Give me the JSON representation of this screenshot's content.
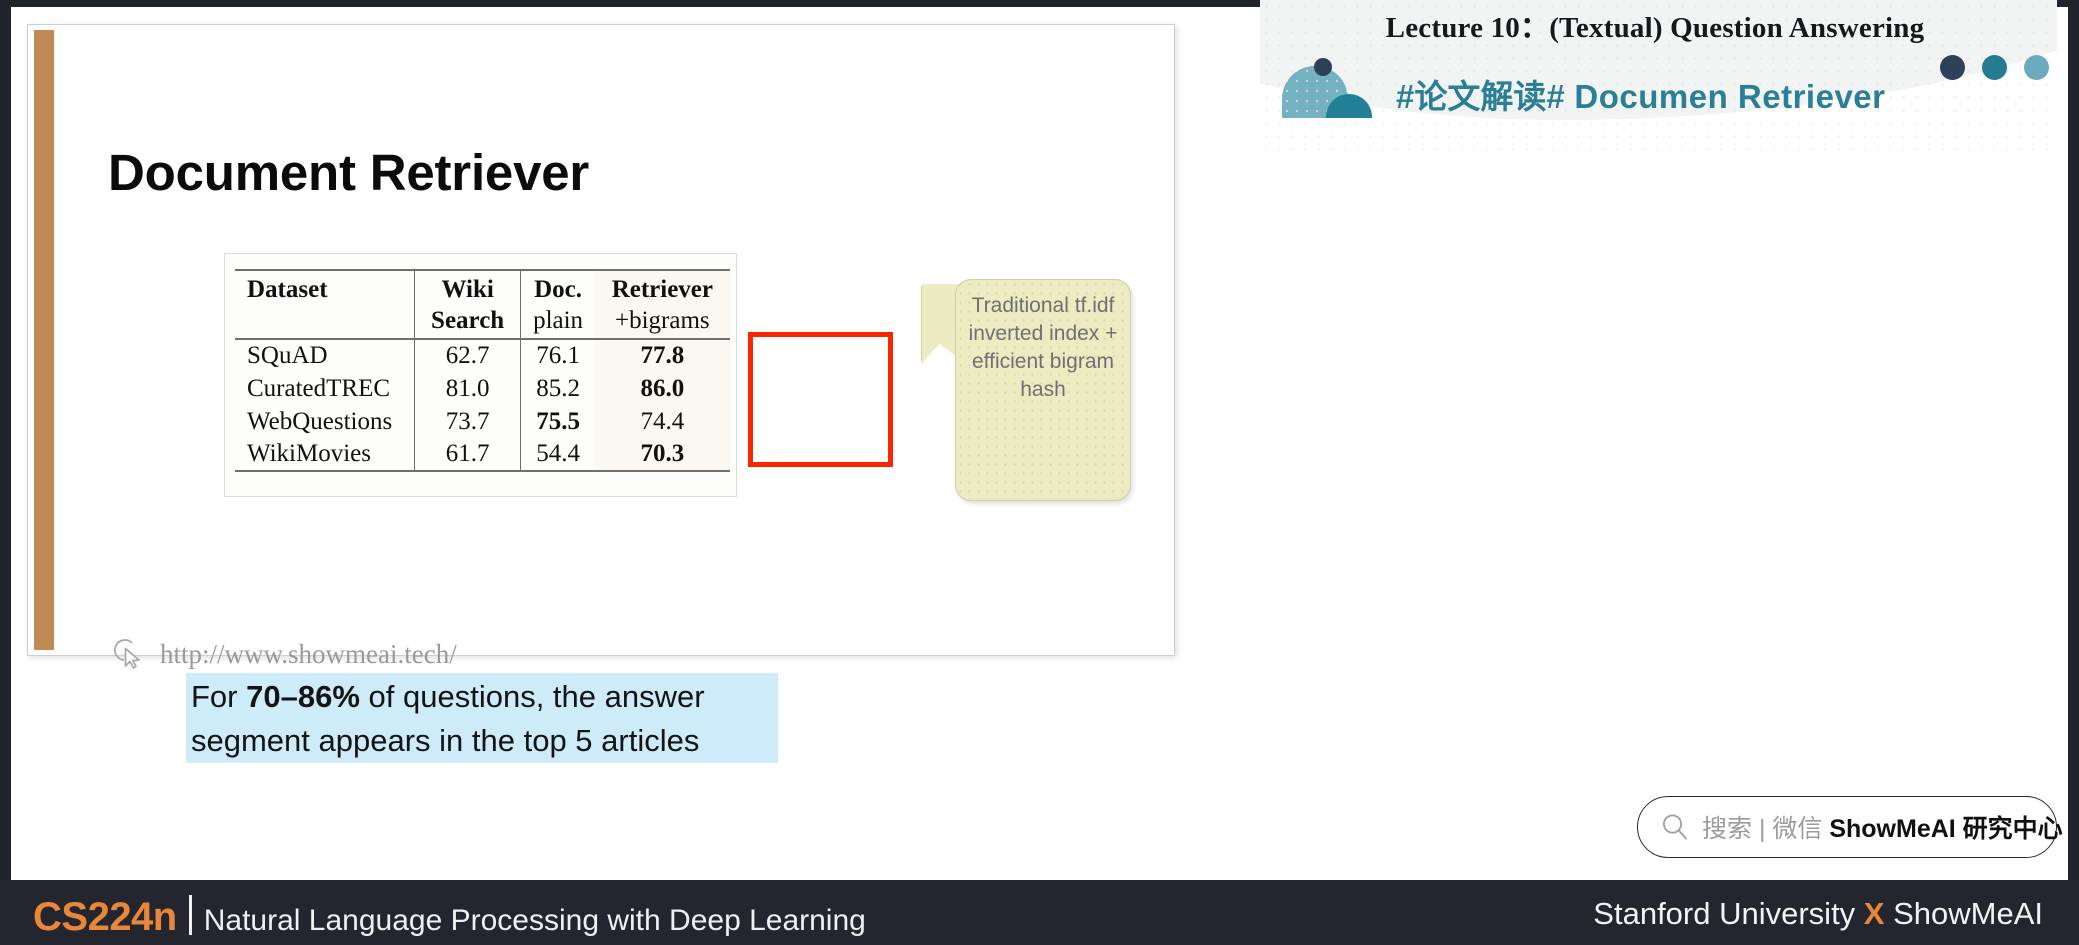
{
  "header": {
    "lecture_title": "Lecture 10：(Textual) Question Answering",
    "logo_text_cn": "#论文解读#",
    "logo_text_en": "Documen Retriever",
    "dot_colors": [
      "#2d4159",
      "#247b92",
      "#6babbd"
    ],
    "accent_teal": "#2a7f96"
  },
  "slide": {
    "title": "Document Retriever",
    "accent_bar_color": "#c08a56",
    "url": "http://www.showmeai.tech/",
    "callout": "Traditional tf.idf inverted index + efficient bigram hash",
    "highlight": {
      "line1_pre": "For ",
      "line1_bold": "70–86%",
      "line1_post": " of questions, the answer",
      "line2": "segment appears in the top 5 articles",
      "bg_color": "#cdebf8"
    },
    "red_box_color": "#fa2600"
  },
  "table": {
    "headers_row1": [
      "Dataset",
      "Wiki",
      "Doc.",
      "Retriever"
    ],
    "headers_row2": [
      "",
      "Search",
      "plain",
      "+bigrams"
    ],
    "rows": [
      {
        "dataset": "SQuAD",
        "wiki_search": "62.7",
        "doc_plain": "76.1",
        "doc_bigrams": "77.8"
      },
      {
        "dataset": "CuratedTREC",
        "wiki_search": "81.0",
        "doc_plain": "85.2",
        "doc_bigrams": "86.0"
      },
      {
        "dataset": "WebQuestions",
        "wiki_search": "73.7",
        "doc_plain": "75.5",
        "doc_bigrams": "74.4"
      },
      {
        "dataset": "WikiMovies",
        "wiki_search": "61.7",
        "doc_plain": "54.4",
        "doc_bigrams": "70.3"
      }
    ]
  },
  "search": {
    "placeholder_grey": "搜索 | 微信 ",
    "brand": "ShowMeAI 研究中心"
  },
  "footer": {
    "course_code": "CS224n",
    "course_name": "Natural Language Processing with Deep Learning",
    "right_pre": "Stanford University ",
    "right_x": "X",
    "right_post": " ShowMeAI",
    "accent_color": "#e8873a"
  }
}
